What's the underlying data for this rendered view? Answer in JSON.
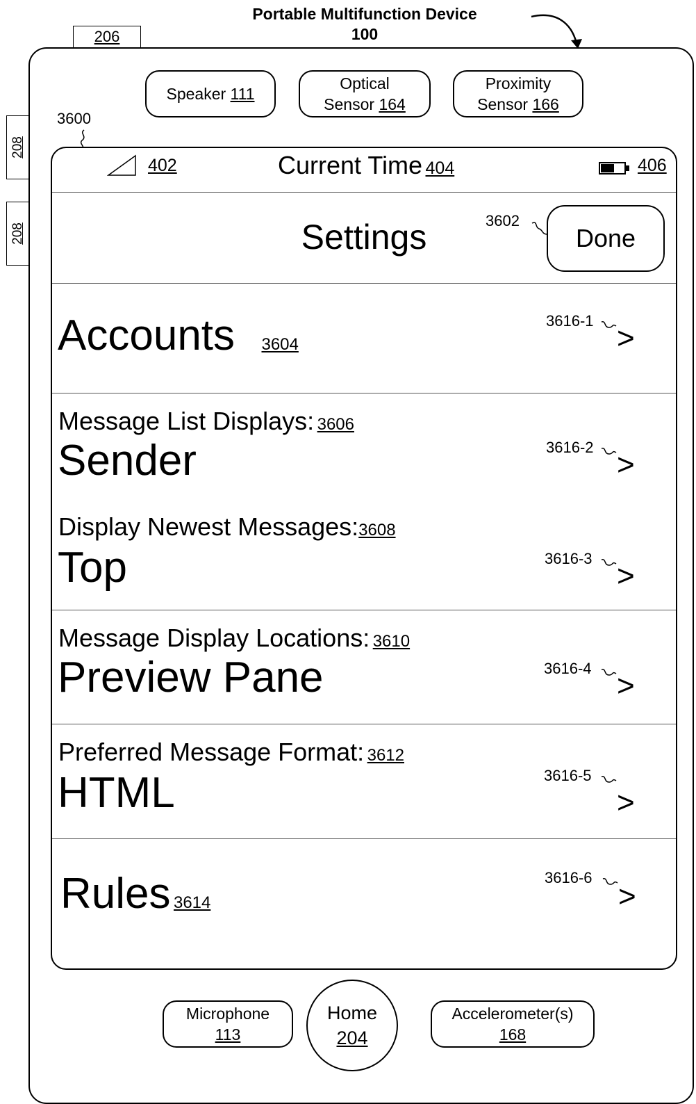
{
  "figure": {
    "title_line1": "Portable Multifunction Device",
    "title_line2": "100",
    "frame_ref": "206",
    "side_button_upper": "208",
    "side_button_lower": "208",
    "screen_ref": "3600"
  },
  "hardware": {
    "speaker": {
      "label": "Speaker",
      "ref": "111"
    },
    "optical_sensor": {
      "line1": "Optical",
      "line2": "Sensor",
      "ref": "164"
    },
    "proximity_sensor": {
      "line1": "Proximity",
      "line2": "Sensor",
      "ref": "166"
    },
    "microphone": {
      "label": "Microphone",
      "ref": "113"
    },
    "home": {
      "label": "Home",
      "ref": "204"
    },
    "accelerometer": {
      "label": "Accelerometer(s)",
      "ref": "168"
    }
  },
  "status_bar": {
    "signal_ref": "402",
    "time_label": "Current Time",
    "time_ref": "404",
    "battery_ref": "406"
  },
  "nav_bar": {
    "title": "Settings",
    "done_label": "Done",
    "done_ref": "3602"
  },
  "settings": {
    "accounts": {
      "value": "Accounts",
      "ref": "3604",
      "chevron_ref": "3616-1"
    },
    "message_list": {
      "label": "Message List Displays:",
      "ref": "3606",
      "value": "Sender",
      "chevron_ref": "3616-2"
    },
    "newest_messages": {
      "label": "Display Newest Messages:",
      "ref": "3608",
      "value": "Top",
      "chevron_ref": "3616-3"
    },
    "display_locations": {
      "label": "Message Display Locations:",
      "ref": "3610",
      "value": "Preview Pane",
      "chevron_ref": "3616-4"
    },
    "message_format": {
      "label": "Preferred Message Format:",
      "ref": "3612",
      "value": "HTML",
      "chevron_ref": "3616-5"
    },
    "rules": {
      "value": "Rules",
      "ref": "3614",
      "chevron_ref": "3616-6"
    },
    "chevron_glyph": ">"
  }
}
